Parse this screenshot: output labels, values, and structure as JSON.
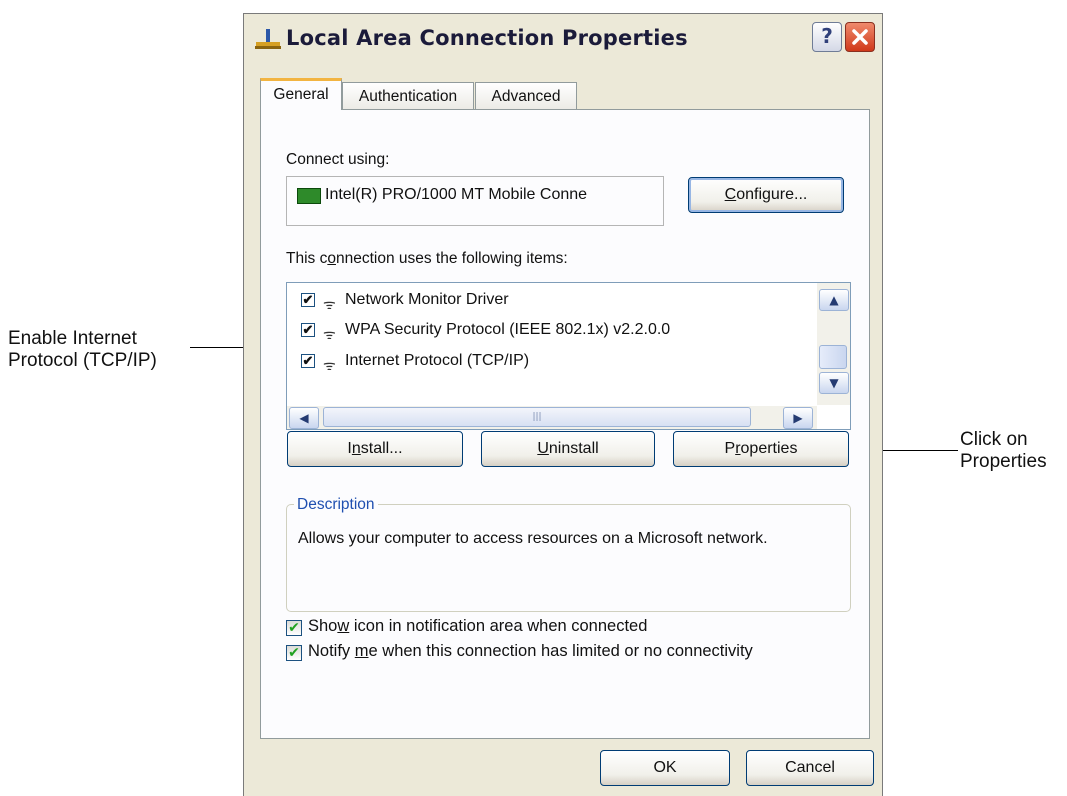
{
  "window": {
    "title": "Local Area Connection Properties",
    "help_glyph": "?",
    "close_icon": "close-icon"
  },
  "tabs": [
    {
      "label": "General",
      "active": true
    },
    {
      "label": "Authentication",
      "active": false
    },
    {
      "label": "Advanced",
      "active": false
    }
  ],
  "connect_using": {
    "label_pre": "Connect using:",
    "adapter": "Intel(R) PRO/1000 MT Mobile Conne",
    "adapter_icon": "network-card-icon",
    "configure_pre": "",
    "configure_u": "C",
    "configure_post": "onfigure..."
  },
  "items_section": {
    "label_pre": "This c",
    "label_u": "o",
    "label_post": "nnection uses the following items:",
    "items": [
      {
        "label": "Network Monitor Driver",
        "checked": true
      },
      {
        "label": "WPA Security Protocol (IEEE 802.1x) v2.2.0.0",
        "checked": true
      },
      {
        "label": "Internet Protocol (TCP/IP)",
        "checked": true
      }
    ],
    "check_glyph": "✔",
    "protocol_glyph": "ᯤ"
  },
  "scrollbars": {
    "up": "▲",
    "down": "▼",
    "left": "◀",
    "right": "▶",
    "grip": "|||"
  },
  "buttons": {
    "install_pre": "I",
    "install_u": "n",
    "install_post": "stall...",
    "uninstall_pre": "",
    "uninstall_u": "U",
    "uninstall_post": "ninstall",
    "properties_pre": "P",
    "properties_u": "r",
    "properties_post": "operties",
    "ok": "OK",
    "cancel": "Cancel"
  },
  "description": {
    "legend": "Description",
    "text": "Allows your computer to access resources on a Microsoft network."
  },
  "options": [
    {
      "pre": "Sho",
      "u": "w",
      "post": " icon in notification area when connected",
      "checked": true
    },
    {
      "pre": "Notify ",
      "u": "m",
      "post": "e when this connection has limited or no connectivity",
      "checked": true
    }
  ],
  "callouts": {
    "left_line1": "Enable Internet",
    "left_line2": "Protocol (TCP/IP)",
    "right_line1": "Click on",
    "right_line2": "Properties"
  },
  "colors": {
    "dialog_bg": "#ece9d8",
    "tab_highlight": "#f2b441",
    "description_legend": "#1f4fb0",
    "checkbox_check": "#21a121"
  }
}
